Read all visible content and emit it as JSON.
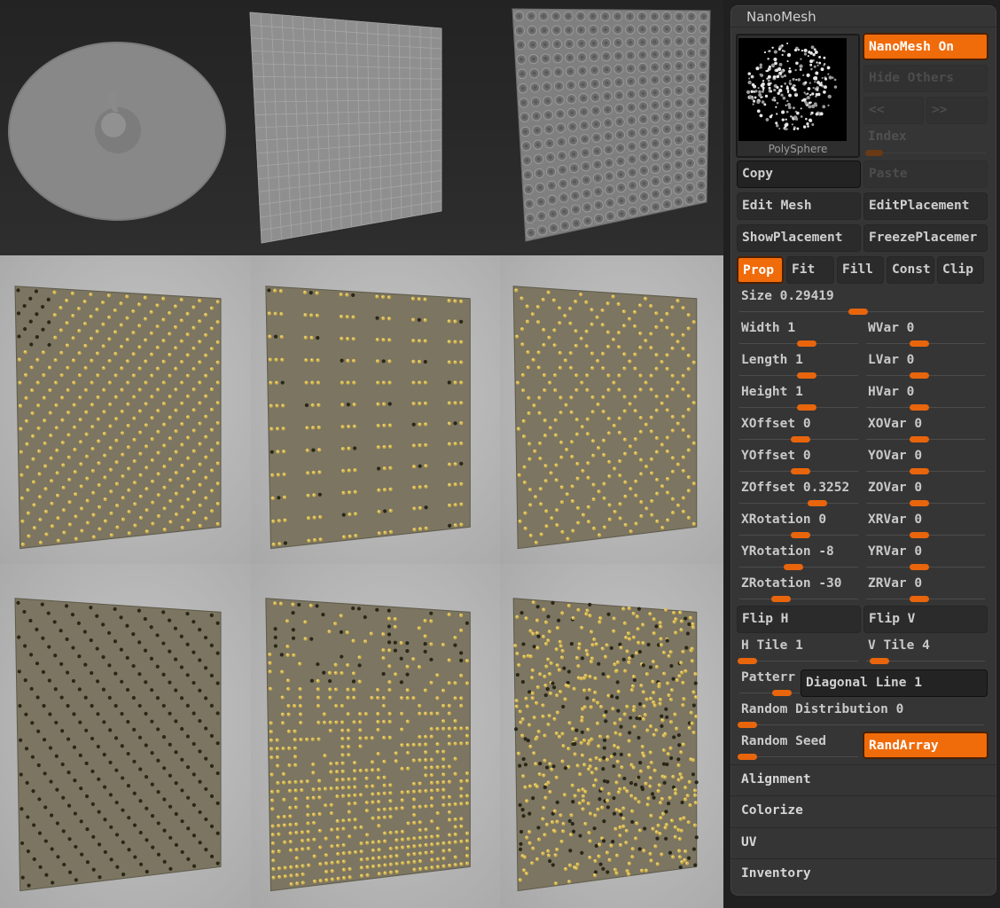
{
  "panel": {
    "title": "NanoMesh",
    "thumbnail_label": "PolySphere",
    "nanomesh_on": "NanoMesh On",
    "hide_others": "Hide Others",
    "prev": "<<",
    "next": ">>",
    "index_label": "Index",
    "copy": "Copy",
    "paste": "Paste",
    "edit_mesh": "Edit Mesh",
    "edit_placement": "EditPlacement",
    "show_placement": "ShowPlacement",
    "freeze_placement": "FreezePlacemer",
    "tabs": [
      "Prop",
      "Fit",
      "Fill",
      "Const",
      "Clip"
    ],
    "size": {
      "label": "Size",
      "value": "0.29419"
    },
    "sliders_left": [
      {
        "label": "Width",
        "value": "1"
      },
      {
        "label": "Length",
        "value": "1"
      },
      {
        "label": "Height",
        "value": "1"
      },
      {
        "label": "XOffset",
        "value": "0"
      },
      {
        "label": "YOffset",
        "value": "0"
      },
      {
        "label": "ZOffset",
        "value": "0.3252"
      },
      {
        "label": "XRotation",
        "value": "0"
      },
      {
        "label": "YRotation",
        "value": "-8"
      },
      {
        "label": "ZRotation",
        "value": "-30"
      }
    ],
    "sliders_right": [
      {
        "label": "WVar",
        "value": "0"
      },
      {
        "label": "LVar",
        "value": "0"
      },
      {
        "label": "HVar",
        "value": "0"
      },
      {
        "label": "XOVar",
        "value": "0"
      },
      {
        "label": "YOVar",
        "value": "0"
      },
      {
        "label": "ZOVar",
        "value": "0"
      },
      {
        "label": "XRVar",
        "value": "0"
      },
      {
        "label": "YRVar",
        "value": "0"
      },
      {
        "label": "ZRVar",
        "value": "0"
      }
    ],
    "flip_h": "Flip H",
    "flip_v": "Flip V",
    "h_tile": {
      "label": "H Tile",
      "value": "1"
    },
    "v_tile": {
      "label": "V Tile",
      "value": "4"
    },
    "pattern_label": "Patterr",
    "pattern_value": "Diagonal Line 1",
    "random_distribution": {
      "label": "Random Distribution",
      "value": "0"
    },
    "random_seed": "Random Seed",
    "rand_array": "RandArray",
    "sections": [
      "Alignment",
      "Colorize",
      "UV",
      "Inventory"
    ]
  },
  "colors": {
    "accent": "#f06b0a",
    "panel_bg": "#353535",
    "button_bg": "#2b2b2b",
    "text": "#cfcfcf",
    "dim_text": "#4c4c4c",
    "gold_studs": "#c8a838"
  }
}
